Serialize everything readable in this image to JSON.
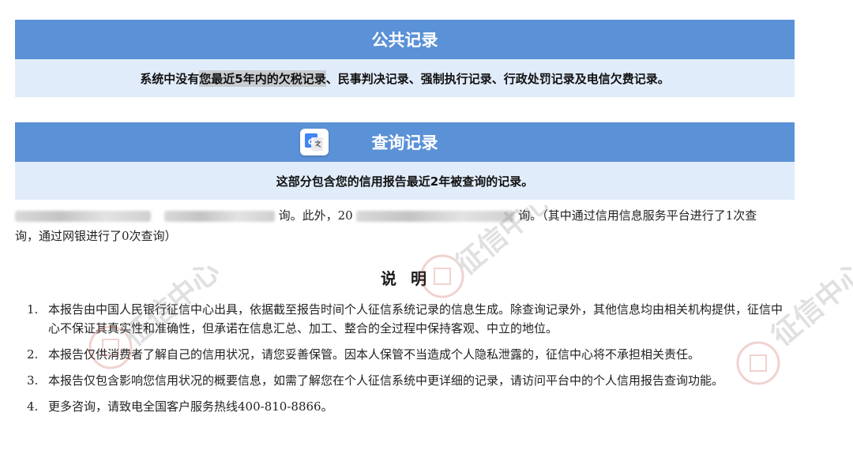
{
  "public_records": {
    "title": "公共记录",
    "body_part1": "系统中没有",
    "body_highlight": "您最近5年内的欠税记录",
    "body_part2": "、民事判决记录、强制执行记录、行政处罚记录及电信欠费记录。"
  },
  "inquiry_records": {
    "title": "查询记录",
    "icon": "google-translate-icon",
    "body": "这部分包含您的信用报告最近2年被查询的记录。",
    "summary_fragment1": "询。此外，20",
    "summary_fragment2": "询。（其中通过信用信息服务平台进行了1次查",
    "summary_line2": "询，通过网银进行了0次查询）"
  },
  "explanation": {
    "title": "说明",
    "items": [
      {
        "num": "1.",
        "text": "本报告由中国人民银行征信中心出具，依据截至报告时间个人征信系统记录的信息生成。除查询记录外，其他信息均由相关机构提供，征信中心不保证其真实性和准确性，但承诺在信息汇总、加工、整合的全过程中保持客观、中立的地位。"
      },
      {
        "num": "2.",
        "text": "本报告仅供消费者了解自己的信用状况，请您妥善保管。因本人保管不当造成个人隐私泄露的，征信中心将不承担相关责任。"
      },
      {
        "num": "3.",
        "text": "本报告仅包含影响您信用状况的概要信息，如需了解您在个人征信系统中更详细的记录，请访问平台中的个人信用报告查询功能。"
      },
      {
        "num": "4.",
        "text": "更多咨询，请致电全国客户服务热线400-810-8866。"
      }
    ]
  },
  "watermark": {
    "text": "征信中心",
    "color": "#c0392b"
  },
  "colors": {
    "header_bg": "#5b91d6",
    "body_bg": "#e1ecfa"
  }
}
